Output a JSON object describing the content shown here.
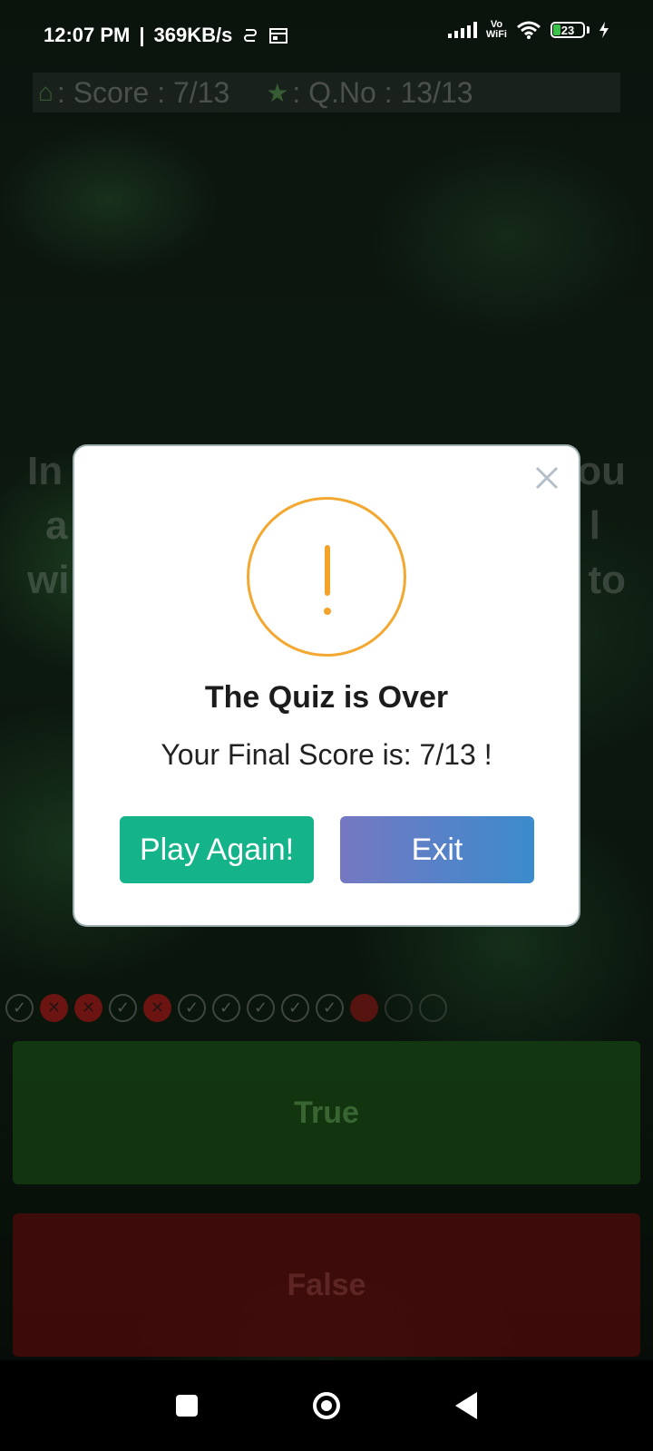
{
  "status_bar": {
    "time": "12:07 PM",
    "separator": "|",
    "speed": "369KB/s",
    "vowifi_top": "Vo",
    "vowifi_bottom": "WiFi",
    "battery": "23"
  },
  "game": {
    "score_label": ": Score : 7/13",
    "question_label": ": Q.No : 13/13",
    "question_fragments": [
      "In",
      "ou",
      "a",
      "l",
      "wi",
      "to"
    ],
    "progress": [
      "ok",
      "bad",
      "bad",
      "ok",
      "bad",
      "ok",
      "ok",
      "ok",
      "ok",
      "ok",
      "cur",
      "empty",
      "empty"
    ],
    "true_label": "True",
    "false_label": "False"
  },
  "modal": {
    "title": "The Quiz is Over",
    "message": "Your Final Score is: 7/13 !",
    "play_again_label": "Play Again!",
    "exit_label": "Exit",
    "accent_color": "#f3a831",
    "play_color": "#14b38a"
  },
  "icons": {
    "score_icon": "home-icon",
    "question_icon": "star-icon",
    "close_icon": "close-icon",
    "alert_icon": "exclamation-icon"
  }
}
